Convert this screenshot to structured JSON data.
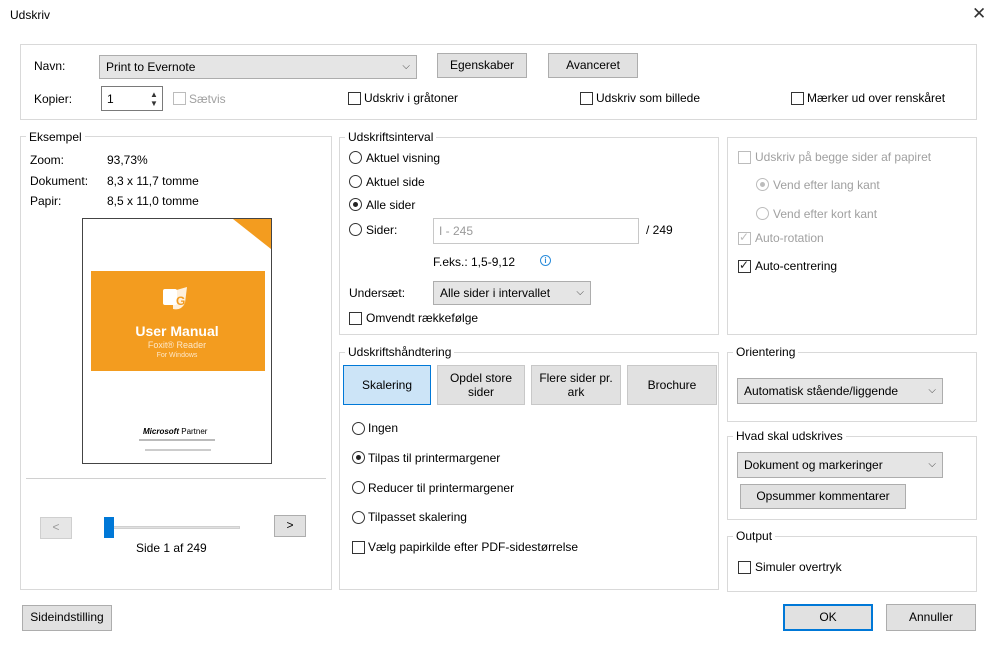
{
  "window": {
    "title": "Udskriv",
    "close_glyph": "✕"
  },
  "printer": {
    "name_label": "Navn:",
    "name_value": "Print to Evernote",
    "properties_label": "Egenskaber",
    "advanced_label": "Avanceret",
    "copies_label": "Kopier:",
    "copies_value": "1",
    "collate_label": "Sætvis",
    "grayscale_label": "Udskriv i gråtoner",
    "as_image_label": "Udskriv som billede",
    "crop_marks_label": "Mærker ud over renskåret"
  },
  "preview": {
    "legend": "Eksempel",
    "zoom_label": "Zoom:",
    "zoom_value": "93,73%",
    "document_label": "Dokument:",
    "document_value": "8,3 x 11,7 tomme",
    "paper_label": "Papir:",
    "paper_value": "8,5 x 11,0 tomme",
    "thumb_title": "User Manual",
    "thumb_subtitle": "Foxit® Reader",
    "thumb_sub2": "For Windows",
    "thumb_partner_brand": "Microsoft",
    "thumb_partner": "Partner",
    "prev_label": "<",
    "next_label": ">",
    "page_indicator": "Side 1 af 249",
    "slider_fraction": 0.0
  },
  "range": {
    "legend": "Udskriftsinterval",
    "current_view": "Aktuel visning",
    "current_page": "Aktuel side",
    "all_pages": "Alle sider",
    "pages_label": "Sider:",
    "pages_placeholder": "I - 245",
    "pages_total": "/ 249",
    "example": "F.eks.: 1,5-9,12",
    "subset_label": "Undersæt:",
    "subset_value": "Alle sider i intervallet",
    "reverse_label": "Omvendt rækkefølge"
  },
  "duplex": {
    "both_sides": "Udskriv på begge sider af papiret",
    "long_edge": "Vend efter lang kant",
    "short_edge": "Vend efter kort kant",
    "auto_rotate": "Auto-rotation",
    "auto_center": "Auto-centrering"
  },
  "handling": {
    "legend": "Udskriftshåndtering",
    "tabs": [
      "Skalering",
      "Opdel store sider",
      "Flere sider pr. ark",
      "Brochure"
    ],
    "none": "Ingen",
    "fit": "Tilpas til printermargener",
    "reduce": "Reducer til printermargener",
    "custom": "Tilpasset skalering",
    "paper_source": "Vælg papirkilde efter PDF-sidestørrelse"
  },
  "orientation": {
    "legend": "Orientering",
    "value": "Automatisk stående/liggende"
  },
  "what_to_print": {
    "legend": "Hvad skal udskrives",
    "value": "Dokument og markeringer",
    "summarize_label": "Opsummer kommentarer"
  },
  "output": {
    "legend": "Output",
    "simulate_label": "Simuler overtryk"
  },
  "footer": {
    "page_setup_label": "Sideindstilling",
    "ok_label": "OK",
    "cancel_label": "Annuller"
  },
  "colors": {
    "accent": "#0078d7",
    "thumb_orange": "#f39c1f"
  },
  "icons": [
    "close-icon",
    "chevron-down-icon",
    "spin-up-icon",
    "spin-down-icon",
    "info-icon"
  ]
}
